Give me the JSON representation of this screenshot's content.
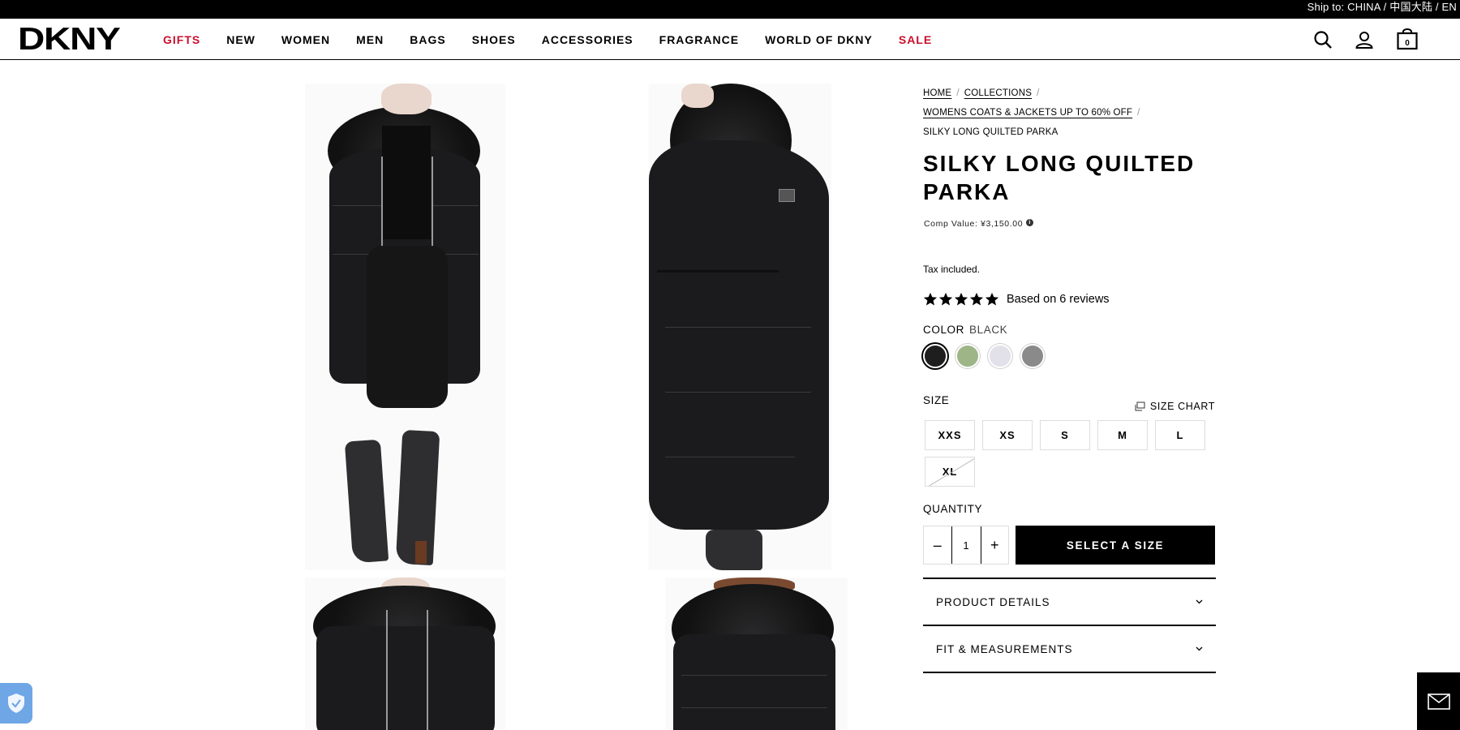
{
  "topbar": {
    "ship_text": "Ship to: CHINA / 中国大陆 / EN"
  },
  "header": {
    "logo": "DKNY",
    "nav": [
      {
        "label": "GIFTS",
        "red": true
      },
      {
        "label": "NEW",
        "red": false
      },
      {
        "label": "WOMEN",
        "red": false
      },
      {
        "label": "MEN",
        "red": false
      },
      {
        "label": "BAGS",
        "red": false
      },
      {
        "label": "SHOES",
        "red": false
      },
      {
        "label": "ACCESSORIES",
        "red": false
      },
      {
        "label": "FRAGRANCE",
        "red": false
      },
      {
        "label": "WORLD OF DKNY",
        "red": false
      },
      {
        "label": "SALE",
        "red": true
      }
    ],
    "cart_count": "0"
  },
  "breadcrumb": {
    "home": "HOME",
    "collections": "COLLECTIONS",
    "category": "WOMENS COATS & JACKETS UP TO 60% OFF",
    "current": "SILKY LONG QUILTED PARKA"
  },
  "product": {
    "title": "SILKY LONG QUILTED PARKA",
    "comp_value": "Comp Value: ¥3,150.00",
    "tax_note": "Tax included.",
    "rating": 5,
    "reviews_text": "Based on 6 reviews",
    "color_label": "COLOR",
    "color_value": "BLACK",
    "swatches": [
      {
        "name": "black",
        "color": "#1e1e1e",
        "selected": true
      },
      {
        "name": "green",
        "color": "#9db587",
        "selected": false
      },
      {
        "name": "light-lavender",
        "color": "#e2e0e8",
        "selected": false
      },
      {
        "name": "grey",
        "color": "#8a8a8a",
        "selected": false
      }
    ],
    "size_label": "SIZE",
    "size_chart_label": "SIZE CHART",
    "sizes": [
      {
        "label": "XXS",
        "available": true
      },
      {
        "label": "XS",
        "available": true
      },
      {
        "label": "S",
        "available": true
      },
      {
        "label": "M",
        "available": true
      },
      {
        "label": "L",
        "available": true
      },
      {
        "label": "XL",
        "available": false
      }
    ],
    "quantity_label": "QUANTITY",
    "quantity": "1",
    "add_button": "SELECT A SIZE",
    "accordions": [
      "PRODUCT DETAILS",
      "FIT & MEASUREMENTS"
    ]
  },
  "colors": {
    "accent_red": "#c8102e",
    "privacy_blue": "#6fa6e6"
  }
}
